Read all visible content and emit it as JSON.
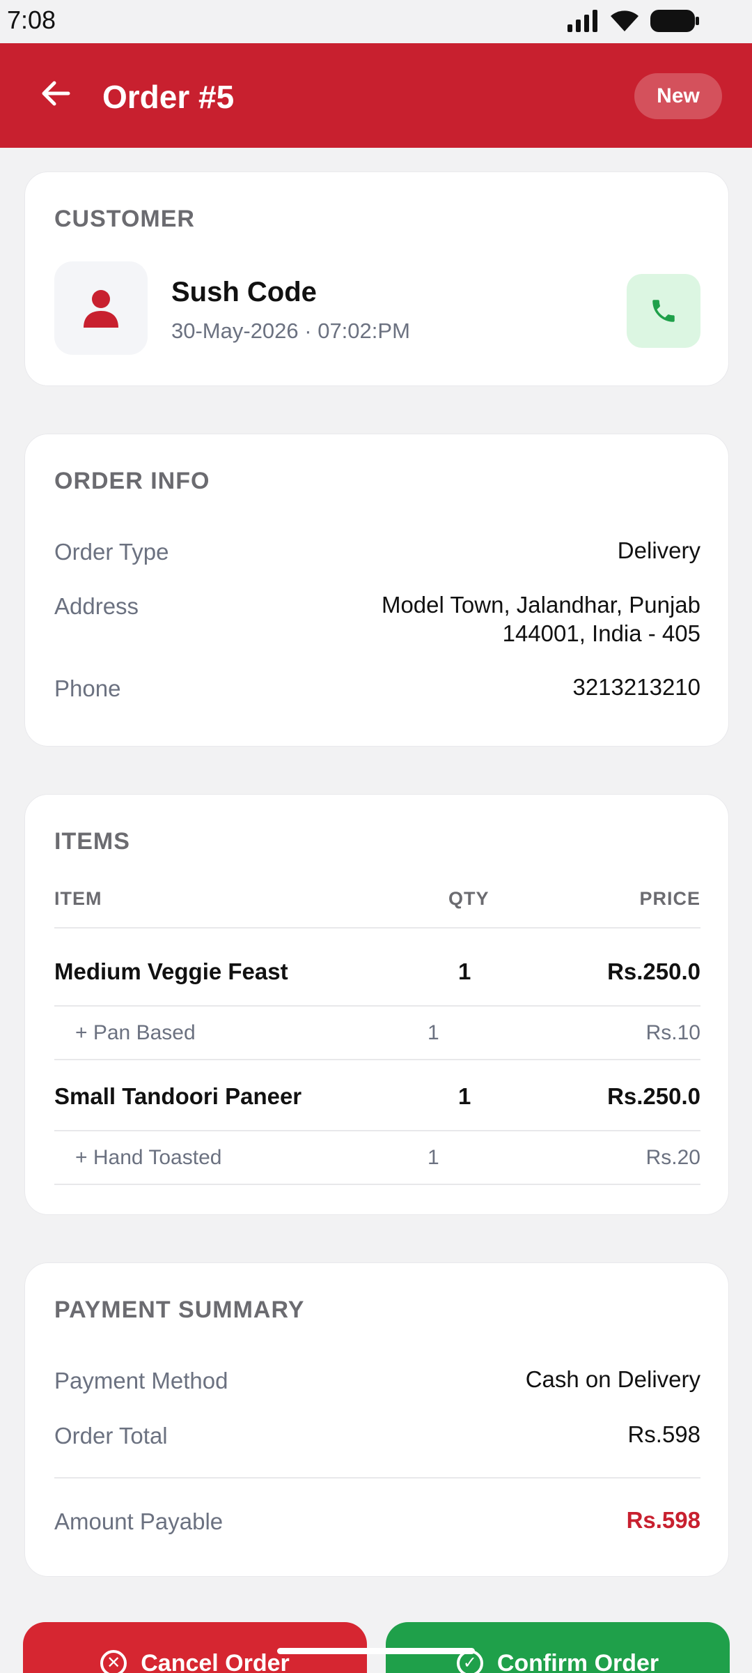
{
  "status_bar": {
    "time": "7:08"
  },
  "app_bar": {
    "title": "Order #5",
    "status": "New"
  },
  "customer": {
    "section_title": "CUSTOMER",
    "name": "Sush Code",
    "datetime": "30-May-2026 · 07:02:PM"
  },
  "order_info": {
    "section_title": "ORDER INFO",
    "rows": [
      {
        "label": "Order Type",
        "value": "Delivery"
      },
      {
        "label": "Address",
        "value": "Model Town, Jalandhar, Punjab",
        "value_line2": "144001, India - 405"
      },
      {
        "label": "Phone",
        "value": "3213213210"
      }
    ]
  },
  "items": {
    "section_title": "ITEMS",
    "headers": {
      "item": "ITEM",
      "qty": "QTY",
      "price": "PRICE"
    },
    "lines": [
      {
        "name": "Medium Veggie Feast",
        "qty": "1",
        "price": "Rs.250.0",
        "addon": {
          "name": "+ Pan Based",
          "qty": "1",
          "price": "Rs.10"
        }
      },
      {
        "name": "Small Tandoori Paneer",
        "qty": "1",
        "price": "Rs.250.0",
        "addon": {
          "name": "+ Hand Toasted",
          "qty": "1",
          "price": "Rs.20"
        }
      }
    ]
  },
  "payment": {
    "section_title": "PAYMENT SUMMARY",
    "method_label": "Payment Method",
    "method_value": "Cash on Delivery",
    "total_label": "Order Total",
    "total_value": "Rs.598",
    "payable_label": "Amount Payable",
    "payable_value": "Rs.598"
  },
  "actions": {
    "cancel": "Cancel Order",
    "confirm": "Confirm Order"
  },
  "colors": {
    "brand": "#c8202f",
    "confirm": "#1fa04a",
    "cancel": "#d62631",
    "call_bg": "#dcf6e2"
  },
  "icons": {
    "back": "arrow-left-icon",
    "avatar": "person-icon",
    "call": "phone-icon",
    "cancel": "x-circle-icon",
    "confirm": "check-circle-icon"
  }
}
